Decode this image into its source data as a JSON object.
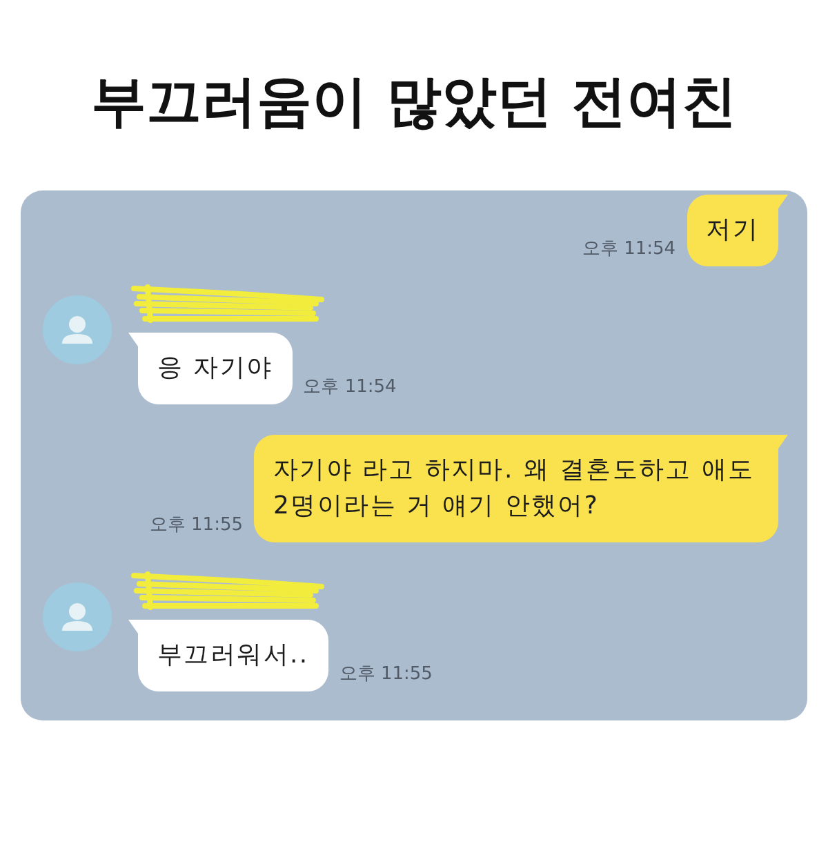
{
  "title": "부끄러움이 많았던 전여친",
  "messages": [
    {
      "kind": "sent",
      "text": "저기",
      "time": "오후 11:54"
    },
    {
      "kind": "received",
      "name_redacted": true,
      "text": "응 자기야",
      "time": "오후 11:54"
    },
    {
      "kind": "sent",
      "text": "자기야 라고 하지마. 왜 결혼도하고 애도 2명이라는 거 얘기 안했어?",
      "time": "오후 11:55"
    },
    {
      "kind": "received",
      "name_redacted": true,
      "text": "부끄러워서..",
      "time": "오후 11:55"
    }
  ]
}
